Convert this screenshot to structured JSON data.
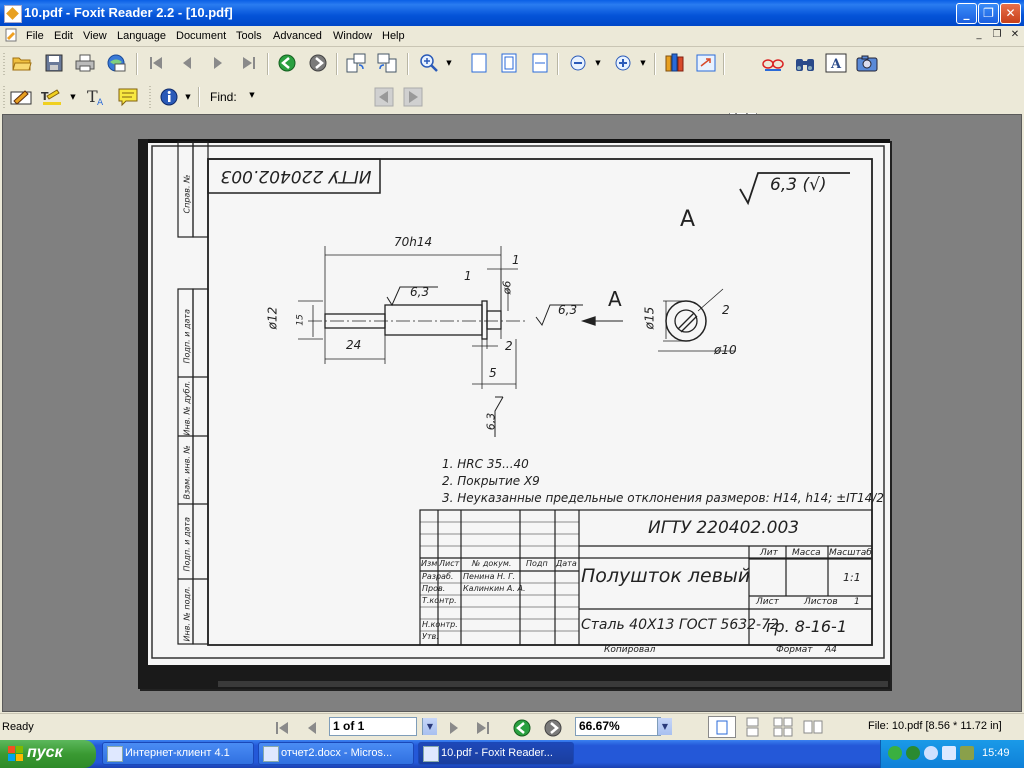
{
  "window": {
    "title": "10.pdf - Foxit Reader 2.2 - [10.pdf]",
    "min_symbol": "_",
    "max_symbol": "❐",
    "close_symbol": "✕"
  },
  "menu": [
    "File",
    "Edit",
    "View",
    "Language",
    "Document",
    "Tools",
    "Advanced",
    "Window",
    "Help"
  ],
  "toolbar": {
    "find_label": "Find:",
    "find_value": ""
  },
  "drawing": {
    "doc_code_top": "ИГТУ 220402.003",
    "roughness_main": "6,3 (√)",
    "view_letter": "А",
    "dim_length": "70h14",
    "dim_1": "1",
    "dim_1b": "1",
    "dim_d6": "ø6",
    "dim_d12": "ø12",
    "dim_15": "15",
    "dim_24": "24",
    "dim_2": "2",
    "dim_5": "5",
    "dim_rough_a": "6,3",
    "dim_rough_b": "6,3",
    "dim_rough_c": "6,3",
    "arrow_letter": "А",
    "dim_d15": "ø15",
    "dim_2b": "2",
    "dim_d10": "ø10",
    "notes": [
      "1. HRC 35...40",
      "2. Покрытие Х9",
      "3. Неуказанные предельные отклонения размеров: H14, h14; ±IT14/2"
    ],
    "stamp": {
      "code": "ИГТУ 220402.003",
      "name": "Полушток левый",
      "material": "Сталь 40Х13 ГОСТ 5632-72",
      "group": "гр. 8-16-1",
      "h_izm": "Изм",
      "h_list": "Лист",
      "h_docum": "№ докум.",
      "h_podp": "Подп",
      "h_data": "Дата",
      "r_razrab": "Разраб.",
      "r_razrab_name": "Пенина Н. Г.",
      "r_prov": "Пров.",
      "r_prov_name": "Калинкин А. А.",
      "r_tkontr": "Т.контр.",
      "r_nkontr": "Н.контр.",
      "r_utv": "Утв.",
      "h_lit": "Лит",
      "h_massa": "Масса",
      "h_masshtab": "Масштаб",
      "scale": "1:1",
      "list_label": "Лист",
      "listov_label": "Листов",
      "listov_val": "1",
      "kopiroval": "Копировал",
      "format": "Формат",
      "format_val": "А4"
    },
    "side": [
      "Справ. №",
      "Подп. и дата",
      "Инв. № дубл.",
      "Взам. инв. №",
      "Подп. и дата",
      "Инв. № подл."
    ]
  },
  "status": {
    "ready": "Ready",
    "page": "1 of 1",
    "zoom": "66.67%",
    "file_info": "File: 10.pdf [8.56 * 11.72 in]"
  },
  "taskbar": {
    "start": "пуск",
    "tasks": [
      "Интернет-клиент 4.1",
      "отчет2.docx - Micros...",
      "10.pdf - Foxit Reader..."
    ],
    "time": "15:49"
  }
}
